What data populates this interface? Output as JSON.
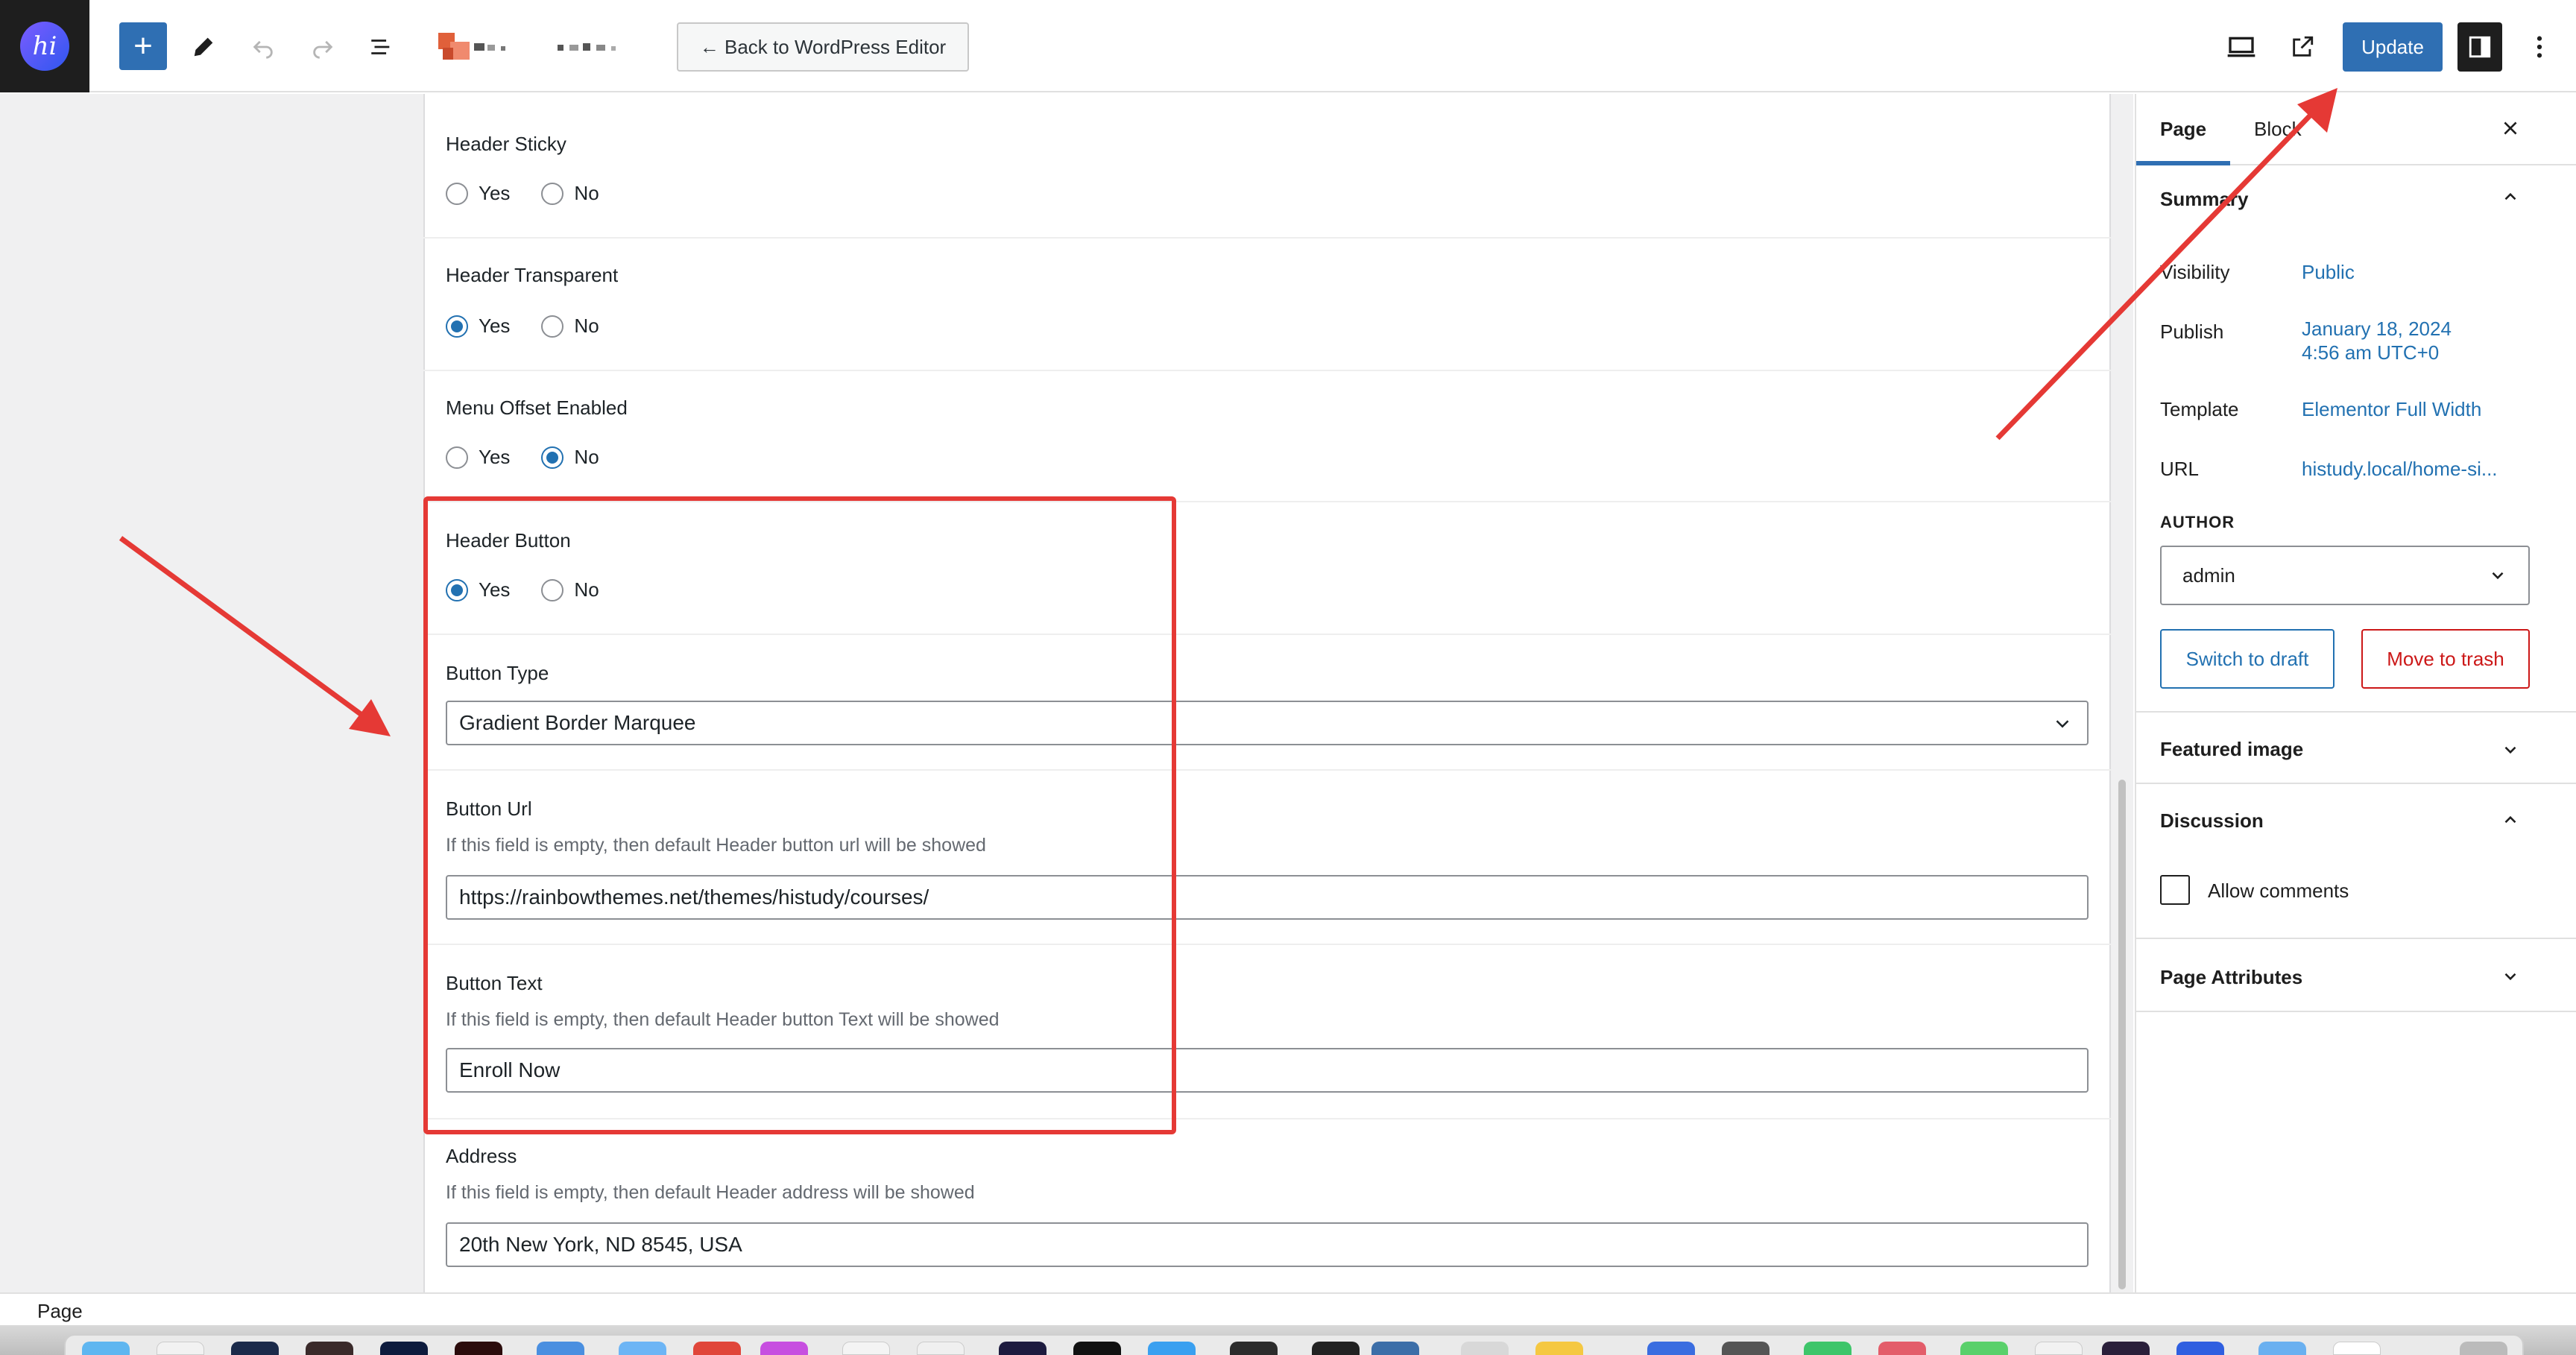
{
  "toolbar": {
    "logo_text": "hi",
    "back_label": "← Back to WordPress Editor",
    "update_label": "Update"
  },
  "fields": {
    "header_sticky": {
      "label": "Header Sticky",
      "yes": "Yes",
      "no": "No",
      "selected": "none"
    },
    "header_transparent": {
      "label": "Header Transparent",
      "yes": "Yes",
      "no": "No",
      "selected": "yes"
    },
    "menu_offset": {
      "label": "Menu Offset Enabled",
      "yes": "Yes",
      "no": "No",
      "selected": "no"
    },
    "header_button": {
      "label": "Header Button",
      "yes": "Yes",
      "no": "No",
      "selected": "yes"
    },
    "button_type": {
      "label": "Button Type",
      "value": "Gradient Border Marquee"
    },
    "button_url": {
      "label": "Button Url",
      "hint": "If this field is empty, then default Header button url will be showed",
      "value": "https://rainbowthemes.net/themes/histudy/courses/"
    },
    "button_text": {
      "label": "Button Text",
      "hint": "If this field is empty, then default Header button Text will be showed",
      "value": "Enroll Now"
    },
    "address": {
      "label": "Address",
      "hint": "If this field is empty, then default Header address will be showed",
      "value": "20th New York, ND 8545, USA"
    }
  },
  "sidebar": {
    "tabs": [
      "Page",
      "Block"
    ],
    "summary_title": "Summary",
    "visibility_label": "Visibility",
    "visibility_value": "Public",
    "publish_label": "Publish",
    "publish_date": "January 18, 2024",
    "publish_time": "4:56 am UTC+0",
    "template_label": "Template",
    "template_value": "Elementor Full Width",
    "url_label": "URL",
    "url_value": "histudy.local/home-si...",
    "author_label": "AUTHOR",
    "author_value": "admin",
    "switch_draft": "Switch to draft",
    "move_trash": "Move to trash",
    "featured_image": "Featured image",
    "discussion": "Discussion",
    "allow_comments": "Allow comments",
    "page_attributes": "Page Attributes"
  },
  "statusbar": {
    "label": "Page"
  },
  "colors": {
    "accent": "#2f6fb3",
    "annotation": "#e53935",
    "link": "#2271b1",
    "danger": "#cc1818"
  }
}
